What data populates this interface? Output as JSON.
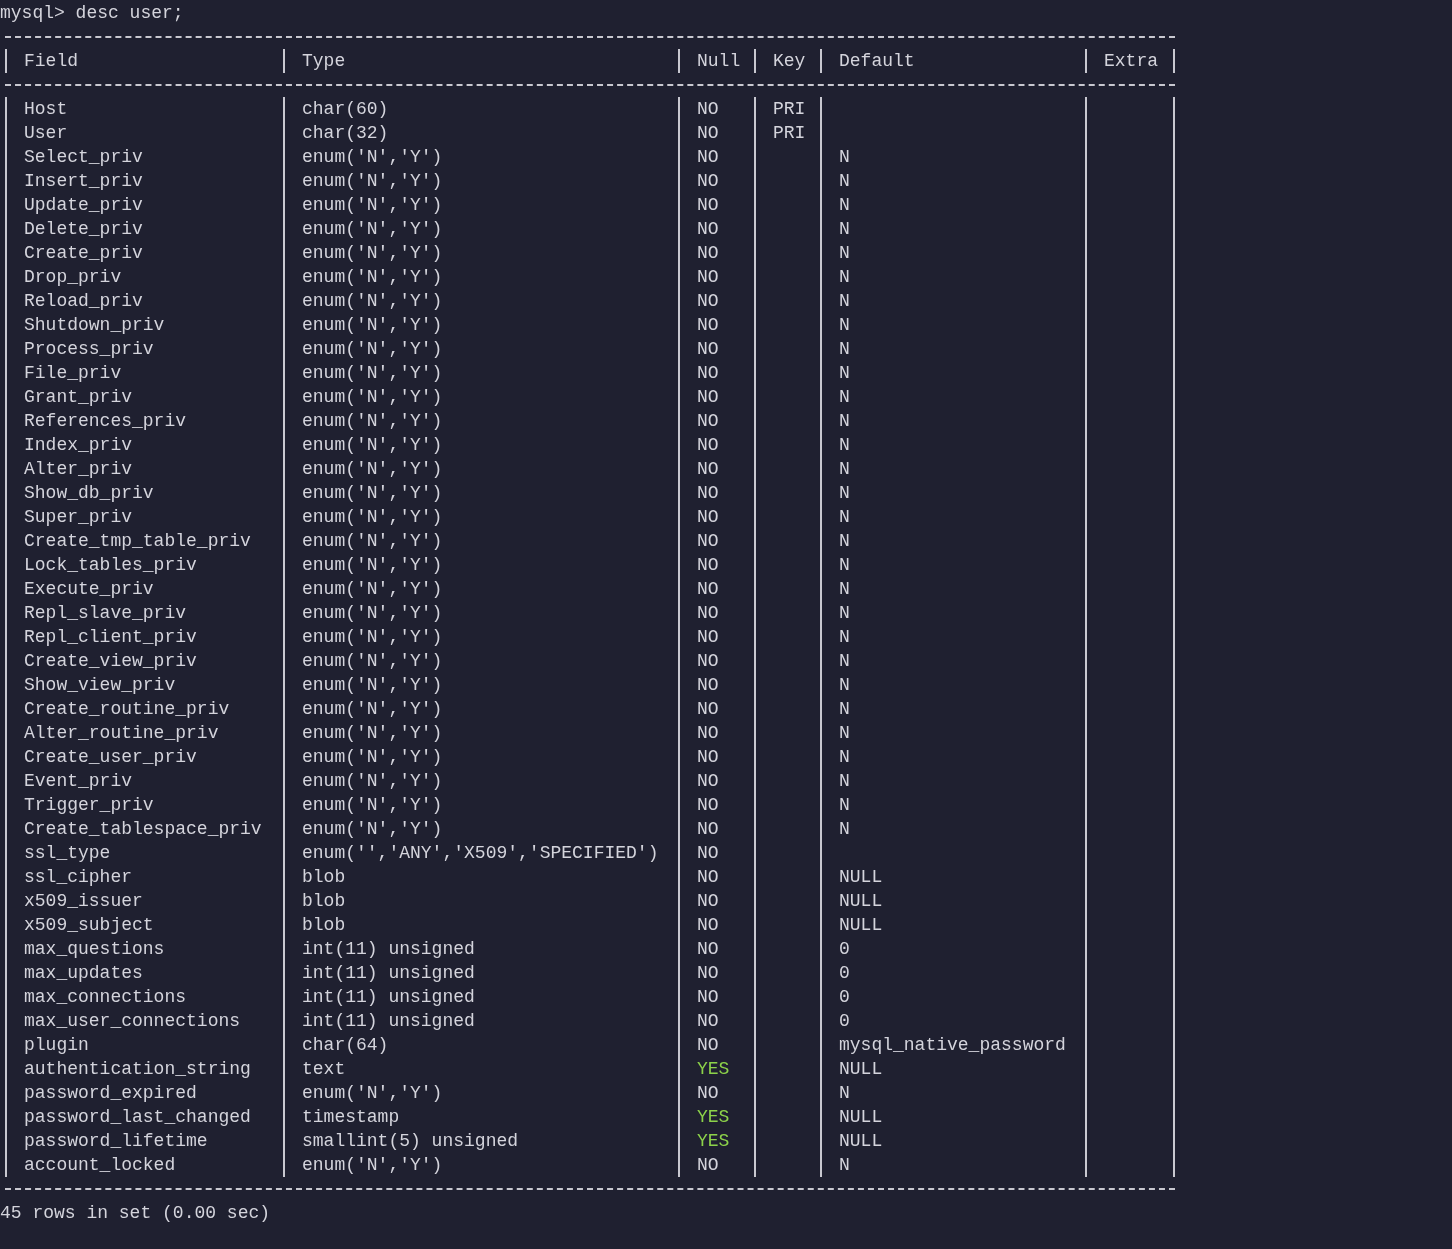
{
  "prompt": "mysql> desc user;",
  "table": {
    "columns": [
      "Field",
      "Type",
      "Null",
      "Key",
      "Default",
      "Extra"
    ],
    "rows": [
      {
        "field": "Host",
        "type": "char(60)",
        "null": "NO",
        "nullable": false,
        "key": "PRI"
      },
      {
        "field": "User",
        "type": "char(32)",
        "null": "NO",
        "nullable": false,
        "key": "PRI"
      },
      {
        "field": "Select_priv",
        "type": "enum('N','Y')",
        "null": "NO",
        "nullable": false,
        "default": "N"
      },
      {
        "field": "Insert_priv",
        "type": "enum('N','Y')",
        "null": "NO",
        "nullable": false,
        "default": "N"
      },
      {
        "field": "Update_priv",
        "type": "enum('N','Y')",
        "null": "NO",
        "nullable": false,
        "default": "N"
      },
      {
        "field": "Delete_priv",
        "type": "enum('N','Y')",
        "null": "NO",
        "nullable": false,
        "default": "N"
      },
      {
        "field": "Create_priv",
        "type": "enum('N','Y')",
        "null": "NO",
        "nullable": false,
        "default": "N"
      },
      {
        "field": "Drop_priv",
        "type": "enum('N','Y')",
        "null": "NO",
        "nullable": false,
        "default": "N"
      },
      {
        "field": "Reload_priv",
        "type": "enum('N','Y')",
        "null": "NO",
        "nullable": false,
        "default": "N"
      },
      {
        "field": "Shutdown_priv",
        "type": "enum('N','Y')",
        "null": "NO",
        "nullable": false,
        "default": "N"
      },
      {
        "field": "Process_priv",
        "type": "enum('N','Y')",
        "null": "NO",
        "nullable": false,
        "default": "N"
      },
      {
        "field": "File_priv",
        "type": "enum('N','Y')",
        "null": "NO",
        "nullable": false,
        "default": "N"
      },
      {
        "field": "Grant_priv",
        "type": "enum('N','Y')",
        "null": "NO",
        "nullable": false,
        "default": "N"
      },
      {
        "field": "References_priv",
        "type": "enum('N','Y')",
        "null": "NO",
        "nullable": false,
        "default": "N"
      },
      {
        "field": "Index_priv",
        "type": "enum('N','Y')",
        "null": "NO",
        "nullable": false,
        "default": "N"
      },
      {
        "field": "Alter_priv",
        "type": "enum('N','Y')",
        "null": "NO",
        "nullable": false,
        "default": "N"
      },
      {
        "field": "Show_db_priv",
        "type": "enum('N','Y')",
        "null": "NO",
        "nullable": false,
        "default": "N"
      },
      {
        "field": "Super_priv",
        "type": "enum('N','Y')",
        "null": "NO",
        "nullable": false,
        "default": "N"
      },
      {
        "field": "Create_tmp_table_priv",
        "type": "enum('N','Y')",
        "null": "NO",
        "nullable": false,
        "default": "N"
      },
      {
        "field": "Lock_tables_priv",
        "type": "enum('N','Y')",
        "null": "NO",
        "nullable": false,
        "default": "N"
      },
      {
        "field": "Execute_priv",
        "type": "enum('N','Y')",
        "null": "NO",
        "nullable": false,
        "default": "N"
      },
      {
        "field": "Repl_slave_priv",
        "type": "enum('N','Y')",
        "null": "NO",
        "nullable": false,
        "default": "N"
      },
      {
        "field": "Repl_client_priv",
        "type": "enum('N','Y')",
        "null": "NO",
        "nullable": false,
        "default": "N"
      },
      {
        "field": "Create_view_priv",
        "type": "enum('N','Y')",
        "null": "NO",
        "nullable": false,
        "default": "N"
      },
      {
        "field": "Show_view_priv",
        "type": "enum('N','Y')",
        "null": "NO",
        "nullable": false,
        "default": "N"
      },
      {
        "field": "Create_routine_priv",
        "type": "enum('N','Y')",
        "null": "NO",
        "nullable": false,
        "default": "N"
      },
      {
        "field": "Alter_routine_priv",
        "type": "enum('N','Y')",
        "null": "NO",
        "nullable": false,
        "default": "N"
      },
      {
        "field": "Create_user_priv",
        "type": "enum('N','Y')",
        "null": "NO",
        "nullable": false,
        "default": "N"
      },
      {
        "field": "Event_priv",
        "type": "enum('N','Y')",
        "null": "NO",
        "nullable": false,
        "default": "N"
      },
      {
        "field": "Trigger_priv",
        "type": "enum('N','Y')",
        "null": "NO",
        "nullable": false,
        "default": "N"
      },
      {
        "field": "Create_tablespace_priv",
        "type": "enum('N','Y')",
        "null": "NO",
        "nullable": false,
        "default": "N"
      },
      {
        "field": "ssl_type",
        "type": "enum('','ANY','X509','SPECIFIED')",
        "null": "NO",
        "nullable": false
      },
      {
        "field": "ssl_cipher",
        "type": "blob",
        "null": "NO",
        "nullable": false,
        "default": "NULL"
      },
      {
        "field": "x509_issuer",
        "type": "blob",
        "null": "NO",
        "nullable": false,
        "default": "NULL"
      },
      {
        "field": "x509_subject",
        "type": "blob",
        "null": "NO",
        "nullable": false,
        "default": "NULL"
      },
      {
        "field": "max_questions",
        "type": "int(11) unsigned",
        "null": "NO",
        "nullable": false,
        "default": "0"
      },
      {
        "field": "max_updates",
        "type": "int(11) unsigned",
        "null": "NO",
        "nullable": false,
        "default": "0"
      },
      {
        "field": "max_connections",
        "type": "int(11) unsigned",
        "null": "NO",
        "nullable": false,
        "default": "0"
      },
      {
        "field": "max_user_connections",
        "type": "int(11) unsigned",
        "null": "NO",
        "nullable": false,
        "default": "0"
      },
      {
        "field": "plugin",
        "type": "char(64)",
        "null": "NO",
        "nullable": false,
        "default": "mysql_native_password"
      },
      {
        "field": "authentication_string",
        "type": "text",
        "null": "YES",
        "nullable": true,
        "default": "NULL"
      },
      {
        "field": "password_expired",
        "type": "enum('N','Y')",
        "null": "NO",
        "nullable": false,
        "default": "N"
      },
      {
        "field": "password_last_changed",
        "type": "timestamp",
        "null": "YES",
        "nullable": true,
        "default": "NULL"
      },
      {
        "field": "password_lifetime",
        "type": "smallint(5) unsigned",
        "null": "YES",
        "nullable": true,
        "default": "NULL"
      },
      {
        "field": "account_locked",
        "type": "enum('N','Y')",
        "null": "NO",
        "nullable": false,
        "default": "N"
      }
    ]
  },
  "result_summary": "45 rows in set (0.00 sec)"
}
